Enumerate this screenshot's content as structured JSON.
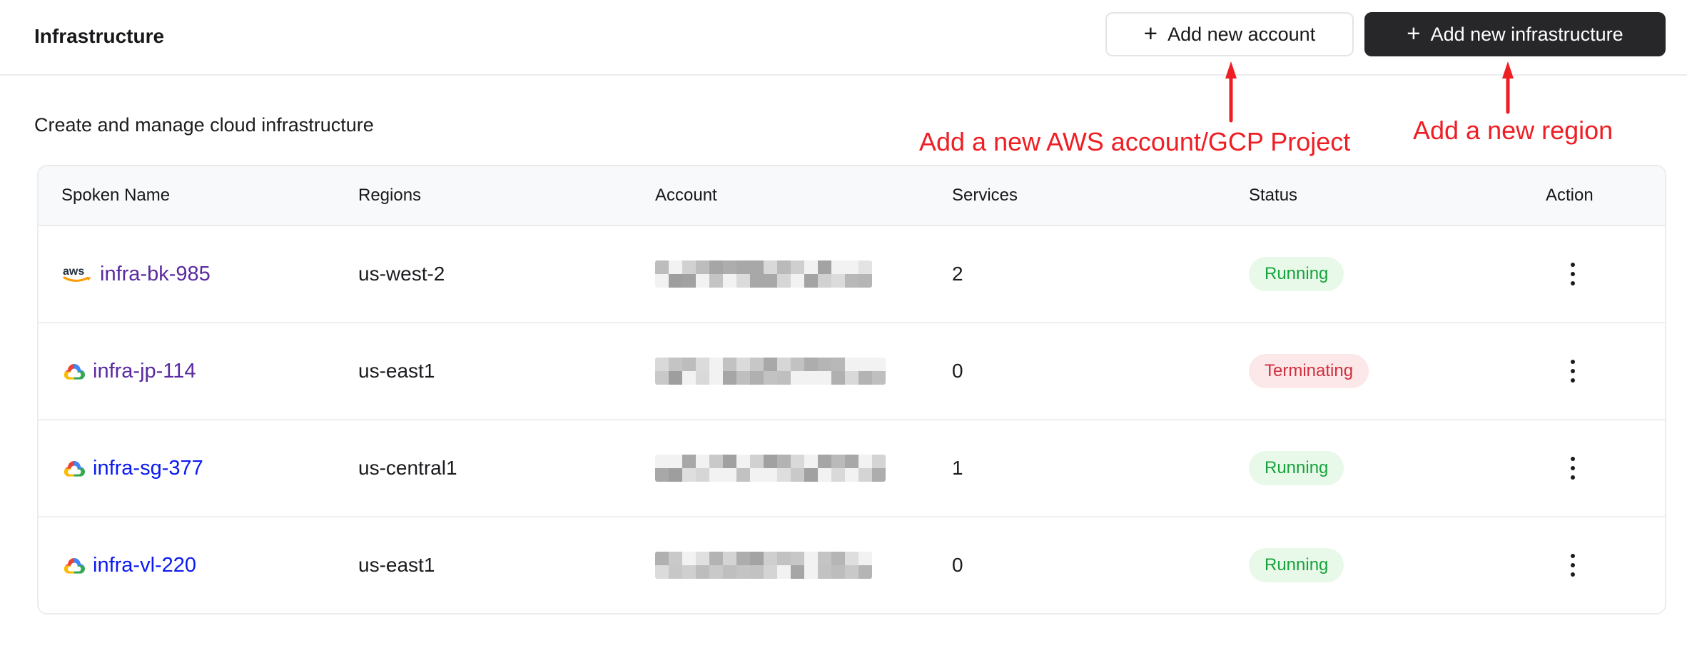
{
  "header": {
    "title": "Infrastructure",
    "plus_glyph": "+",
    "buttons": [
      {
        "label": "Add new account",
        "variant": "secondary"
      },
      {
        "label": "Add new infrastructure",
        "variant": "primary"
      }
    ]
  },
  "subtitle": "Create and manage cloud infrastructure",
  "annotations": {
    "color": "#ee1e24",
    "items": [
      {
        "text": "Add a new AWS account/GCP Project",
        "points_to": "Add new account button"
      },
      {
        "text": "Add a new region",
        "points_to": "Add new infrastructure button"
      }
    ]
  },
  "palette": {
    "primary_button_bg": "#27272a",
    "annotation_red": "#ee1e24",
    "aws_smile_orange": "#ff9900",
    "aws_text": "#232f3e",
    "gcp_blue": "#4285F4",
    "gcp_red": "#EA4335",
    "gcp_yellow": "#FBBC05",
    "gcp_green": "#34A853",
    "visited_link_purple": "#5a2aa0",
    "link_blue": "#0a1af0"
  },
  "table": {
    "columns": [
      "Spoken Name",
      "Regions",
      "Account",
      "Services",
      "Status",
      "Action"
    ],
    "statuses": {
      "Running": {
        "text_color": "#17a23c",
        "bg_color": "#e8f9e9"
      },
      "Terminating": {
        "text_color": "#d02f3f",
        "bg_color": "#fce8e8"
      }
    },
    "rows": [
      {
        "name": "infra-bk-985",
        "provider": "aws",
        "name_color": "#5a2aa0",
        "region": "us-west-2",
        "account_redacted": true,
        "services": "2",
        "status": "Running"
      },
      {
        "name": "infra-jp-114",
        "provider": "gcp",
        "name_color": "#5a2aa0",
        "region": "us-east1",
        "account_redacted": true,
        "services": "0",
        "status": "Terminating"
      },
      {
        "name": "infra-sg-377",
        "provider": "gcp",
        "name_color": "#0a1af0",
        "region": "us-central1",
        "account_redacted": true,
        "services": "1",
        "status": "Running"
      },
      {
        "name": "infra-vl-220",
        "provider": "gcp",
        "name_color": "#0a1af0",
        "region": "us-east1",
        "account_redacted": true,
        "services": "0",
        "status": "Running"
      }
    ]
  }
}
